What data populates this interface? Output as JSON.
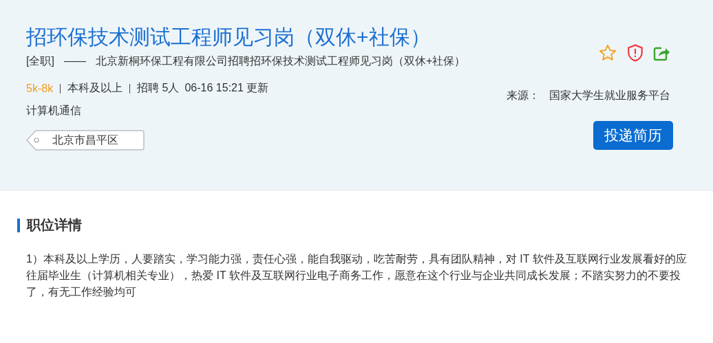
{
  "job": {
    "title": "招环保技术测试工程师见习岗（双休+社保）",
    "job_type": "[全职]",
    "separator": "——",
    "subtitle": "北京新桐环保工程有限公司招聘招环保技术测试工程师见习岗（双休+社保）",
    "salary": "5k-8k",
    "education": "本科及以上",
    "hiring": "招聘 5人",
    "updated": "06-16 15:21 更新",
    "major": "计算机通信",
    "location": "北京市昌平区"
  },
  "source": {
    "label": "来源：",
    "value": "国家大学生就业服务平台"
  },
  "apply_button": "投递简历",
  "section": {
    "title": "职位详情",
    "description": "1）本科及以上学历，人要踏实，学习能力强，责任心强，能自我驱动，吃苦耐劳，具有团队精神，对 IT 软件及互联网行业发展看好的应往届毕业生（计算机相关专业），热爱 IT 软件及互联网行业电子商务工作，愿意在这个行业与企业共同成长发展；不踏实努力的不要投了，有无工作经验均可"
  }
}
